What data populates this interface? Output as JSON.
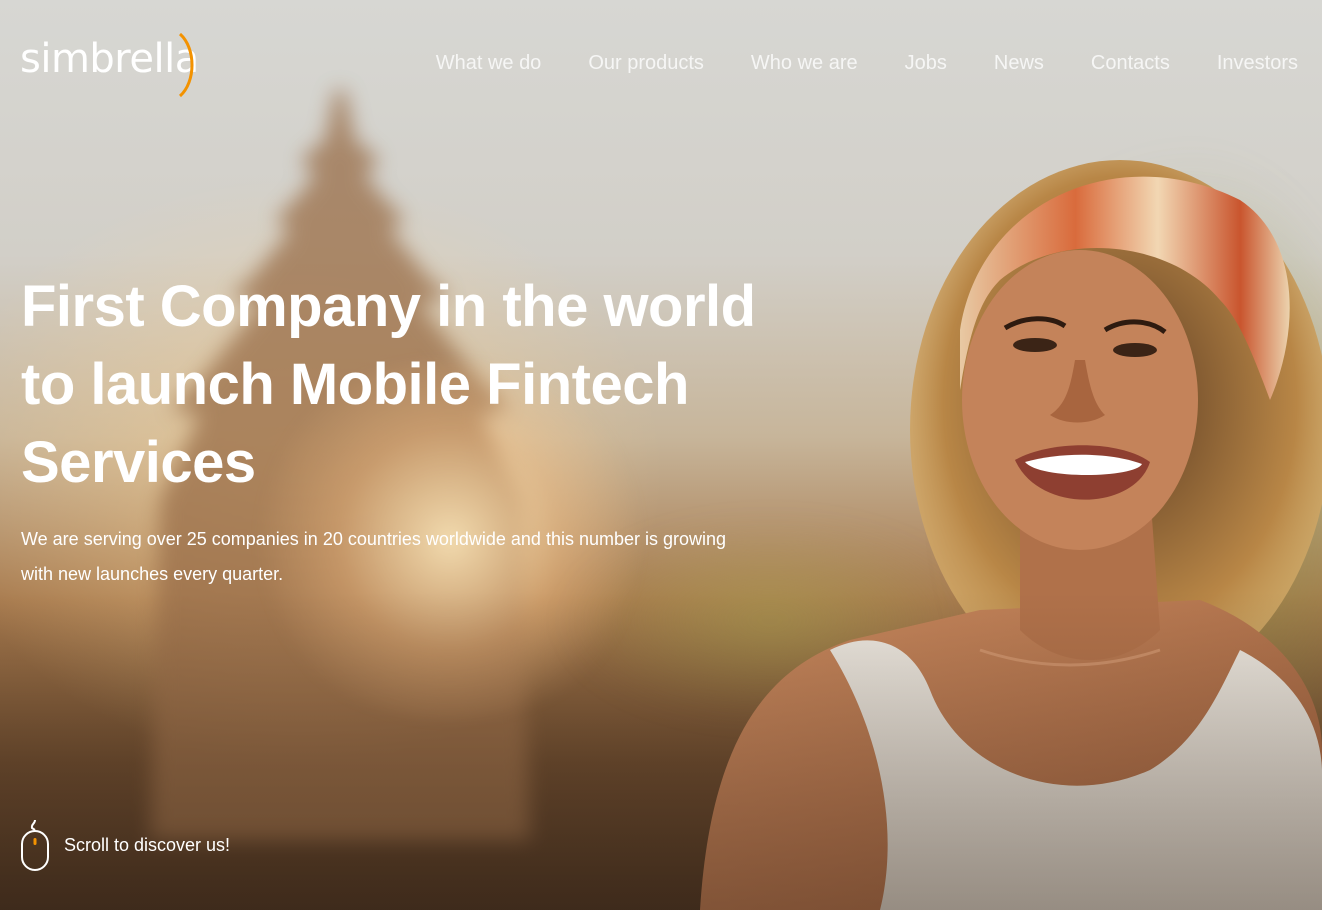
{
  "brand": {
    "logo_text": "simbrella",
    "accent_color": "#f39200"
  },
  "nav": {
    "items": [
      {
        "label": "What we do"
      },
      {
        "label": "Our products"
      },
      {
        "label": "Who we are"
      },
      {
        "label": "Jobs"
      },
      {
        "label": "News"
      },
      {
        "label": "Contacts"
      },
      {
        "label": "Investors"
      }
    ]
  },
  "hero": {
    "headline_lines": [
      "First Company in the world",
      "to launch Mobile Fintech",
      "Services"
    ],
    "subtitle_lines": [
      "We are serving over 25 companies in 20 countries worldwide and this number is growing",
      "with new launches every quarter."
    ]
  },
  "scroll_hint": {
    "label": "Scroll to discover us!",
    "icon": "mouse-icon"
  }
}
